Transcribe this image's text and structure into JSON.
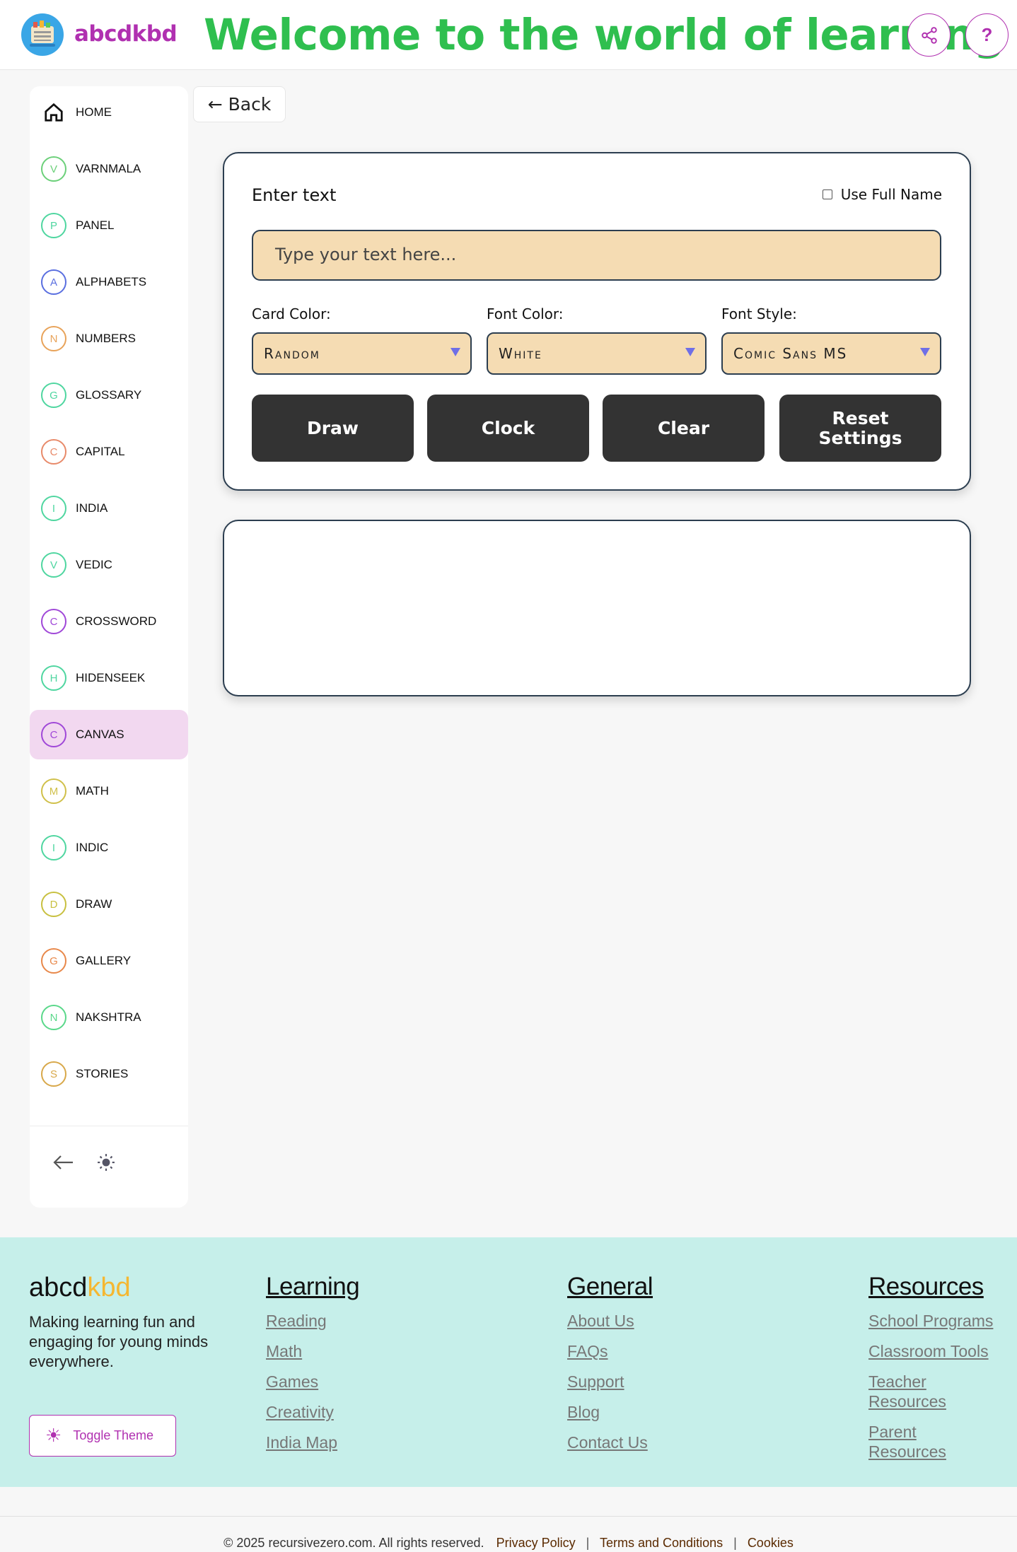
{
  "header": {
    "brand": "abcdkbd",
    "welcome": "Welcome to the world of learning",
    "share_icon": "share-icon",
    "help_label": "?"
  },
  "sidebar": {
    "items": [
      {
        "label": "HOME",
        "letter": "",
        "color": "#111111"
      },
      {
        "label": "VARNMALA",
        "letter": "V",
        "color": "#6cd07a"
      },
      {
        "label": "PANEL",
        "letter": "P",
        "color": "#4fd6a0"
      },
      {
        "label": "ALPHABETS",
        "letter": "A",
        "color": "#5a6fe0"
      },
      {
        "label": "NUMBERS",
        "letter": "N",
        "color": "#e8a35a"
      },
      {
        "label": "GLOSSARY",
        "letter": "G",
        "color": "#4fd6a0"
      },
      {
        "label": "CAPITAL",
        "letter": "C",
        "color": "#e88a6a"
      },
      {
        "label": "INDIA",
        "letter": "I",
        "color": "#4fd6a0"
      },
      {
        "label": "VEDIC",
        "letter": "V",
        "color": "#4fd6a0"
      },
      {
        "label": "CROSSWORD",
        "letter": "C",
        "color": "#a048d8"
      },
      {
        "label": "HIDENSEEK",
        "letter": "H",
        "color": "#4fd6a0"
      },
      {
        "label": "CANVAS",
        "letter": "C",
        "color": "#a048d8"
      },
      {
        "label": "MATH",
        "letter": "M",
        "color": "#d0c04a"
      },
      {
        "label": "INDIC",
        "letter": "I",
        "color": "#4fd6a0"
      },
      {
        "label": "DRAW",
        "letter": "D",
        "color": "#c8c040"
      },
      {
        "label": "GALLERY",
        "letter": "G",
        "color": "#e8884a"
      },
      {
        "label": "NAKSHTRA",
        "letter": "N",
        "color": "#5ad88a"
      },
      {
        "label": "STORIES",
        "letter": "S",
        "color": "#d8a84a"
      }
    ],
    "active": "CANVAS",
    "collapse_icon": "arrow-left-icon",
    "theme_icon": "sun-icon"
  },
  "back": {
    "label": "← Back"
  },
  "editor": {
    "enter_text_label": "Enter text",
    "use_full_name_label": "Use Full Name",
    "use_full_name_checked": false,
    "text_input_placeholder": "Type your text here...",
    "text_input_value": "",
    "card_color_label": "Card Color:",
    "card_color_value": "Random",
    "font_color_label": "Font Color:",
    "font_color_value": "White",
    "font_style_label": "Font Style:",
    "font_style_value": "Comic Sans MS",
    "buttons": [
      "Draw",
      "Clock",
      "Clear",
      "Reset Settings"
    ]
  },
  "footer": {
    "brand_a": "abcd",
    "brand_b": "kbd",
    "tagline": "Making learning fun and engaging for young minds everywhere.",
    "toggle_theme": "Toggle Theme",
    "columns": [
      {
        "title": "Learning",
        "links": [
          "Reading",
          "Math",
          "Games",
          "Creativity",
          "India Map"
        ]
      },
      {
        "title": "General",
        "links": [
          "About Us",
          "FAQs",
          "Support",
          "Blog",
          "Contact Us"
        ]
      },
      {
        "title": "Resources",
        "links": [
          "School Programs",
          "Classroom Tools",
          "Teacher Resources",
          "Parent Resources"
        ]
      }
    ],
    "copyright": "© 2025 recursivezero.com. All rights reserved.",
    "privacy": "Privacy Policy",
    "terms": "Terms and Conditions",
    "cookies": "Cookies"
  },
  "colors": {
    "brand_purple": "#b030b0",
    "welcome_green": "#2fbf4f",
    "input_bg": "#f5dcb3",
    "button_bg": "#333333",
    "footer_bg": "#c6efea",
    "active_nav_bg": "#f2d8f0",
    "brand_yellow": "#f5b731"
  }
}
